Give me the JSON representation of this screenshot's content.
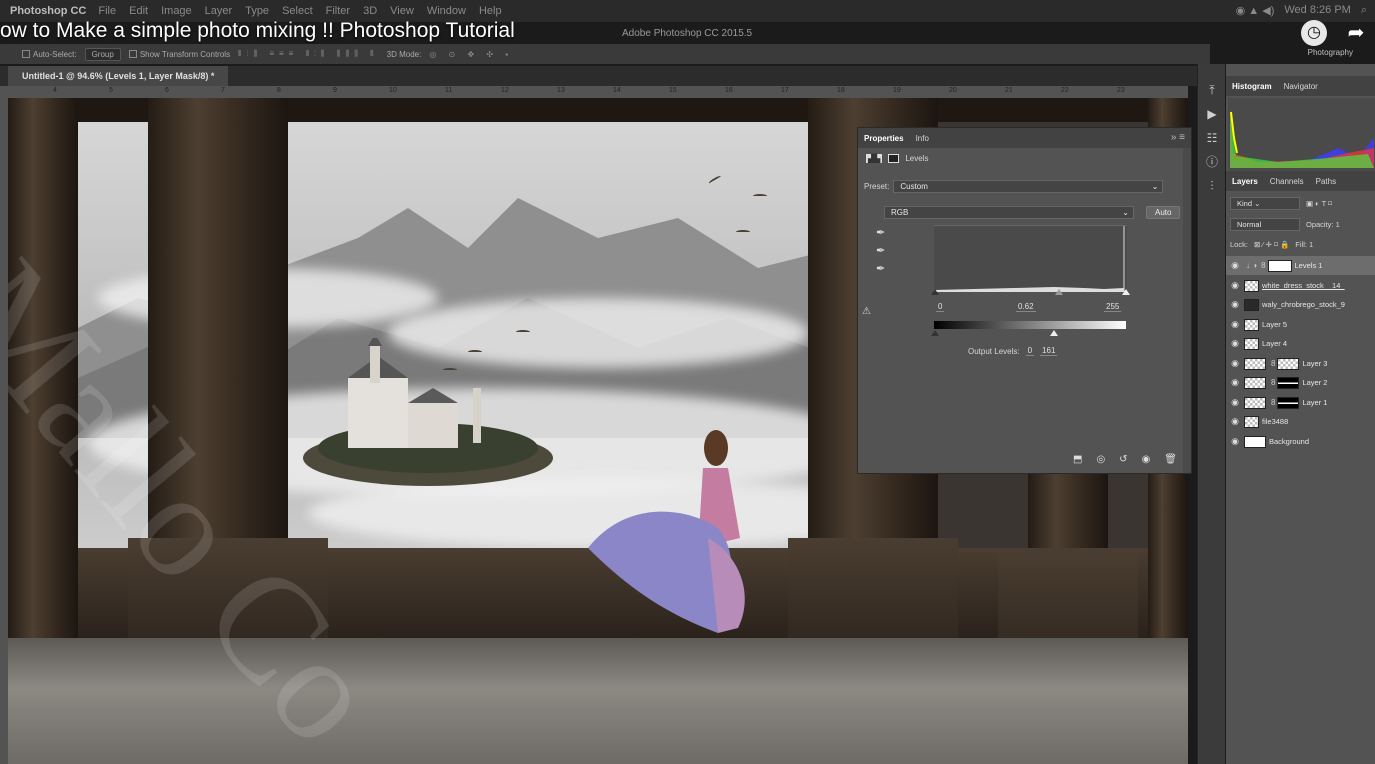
{
  "menubar": {
    "app": "Photoshop CC",
    "items": [
      "File",
      "Edit",
      "Image",
      "Layer",
      "Type",
      "Select",
      "Filter",
      "3D",
      "View",
      "Window",
      "Help"
    ],
    "clock": "Wed 8:26 PM"
  },
  "video_title": "ow to Make a simple photo mixing !! Photoshop Tutorial",
  "app_title": "Adobe Photoshop CC 2015.5",
  "workspace": "Photography",
  "options": {
    "auto_select": "Auto-Select:",
    "group": "Group",
    "transform": "Show Transform Controls",
    "mode3d": "3D Mode:"
  },
  "document_tab": "Untitled-1 @ 94.6% (Levels 1, Layer Mask/8) *",
  "ruler_ticks": [
    "4",
    "5",
    "6",
    "7",
    "8",
    "9",
    "10",
    "11",
    "12",
    "13",
    "14",
    "15",
    "16",
    "17",
    "18",
    "19",
    "20",
    "21",
    "22",
    "23"
  ],
  "watermark": "Mallo Co",
  "properties": {
    "tabs": [
      "Properties",
      "Info"
    ],
    "adjustment": "Levels",
    "preset_label": "Preset:",
    "preset_value": "Custom",
    "channel": "RGB",
    "auto": "Auto",
    "input_black": "0",
    "input_gamma": "0.62",
    "input_white": "255",
    "output_label": "Output Levels:",
    "output_black": "0",
    "output_white": "161"
  },
  "right_panel": {
    "top_tabs": [
      "Histogram",
      "Navigator"
    ],
    "layer_tabs": [
      "Layers",
      "Channels",
      "Paths"
    ],
    "kind": "Kind",
    "blend": "Normal",
    "opacity": "Opacity: 1",
    "lock": "Lock:",
    "fill": "Fill: 1",
    "layers": [
      {
        "name": "Levels 1",
        "selected": true
      },
      {
        "name": "white_dress_stock__14_"
      },
      {
        "name": "waly_chrobrego_stock_9"
      },
      {
        "name": "Layer 5"
      },
      {
        "name": "Layer 4"
      },
      {
        "name": "Layer 3"
      },
      {
        "name": "Layer 2"
      },
      {
        "name": "Layer 1"
      },
      {
        "name": "file3488"
      },
      {
        "name": "Background"
      }
    ]
  }
}
